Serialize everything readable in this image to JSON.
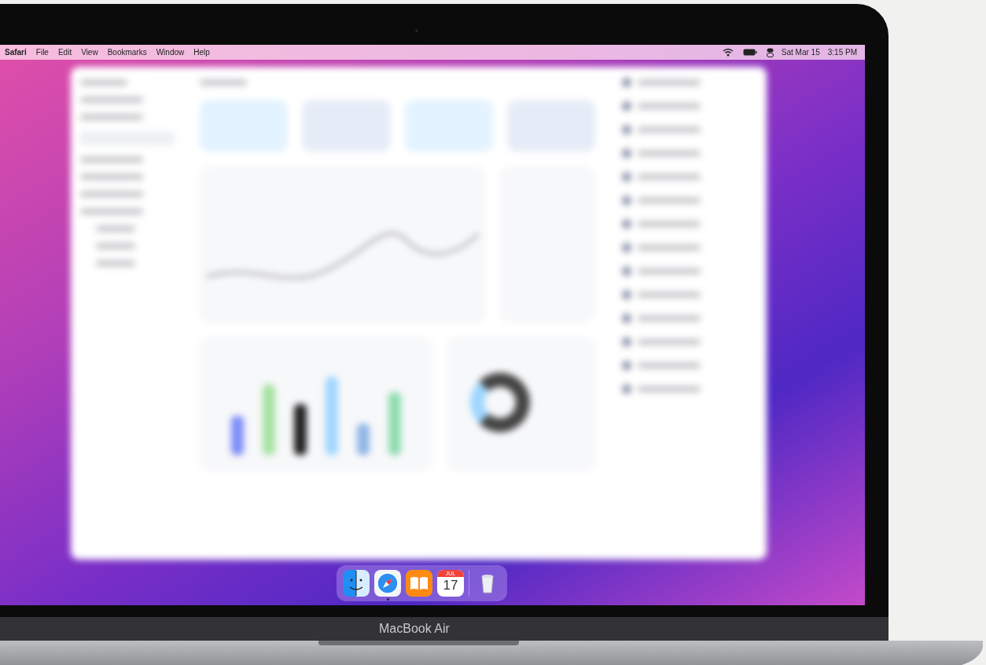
{
  "menu_bar": {
    "app_name": "Safari",
    "menus": [
      "File",
      "Edit",
      "View",
      "Bookmarks",
      "Window",
      "Help"
    ],
    "date": "Sat Mar 15",
    "time": "3:15 PM"
  },
  "dock": {
    "items": [
      {
        "kind": "finder",
        "running": false
      },
      {
        "kind": "browser",
        "running": true
      },
      {
        "kind": "books",
        "running": false
      },
      {
        "kind": "calendar",
        "running": false,
        "month": "JUL",
        "day": "17"
      },
      {
        "kind": "trash",
        "running": false
      }
    ]
  },
  "device_label": "MacBook Air"
}
